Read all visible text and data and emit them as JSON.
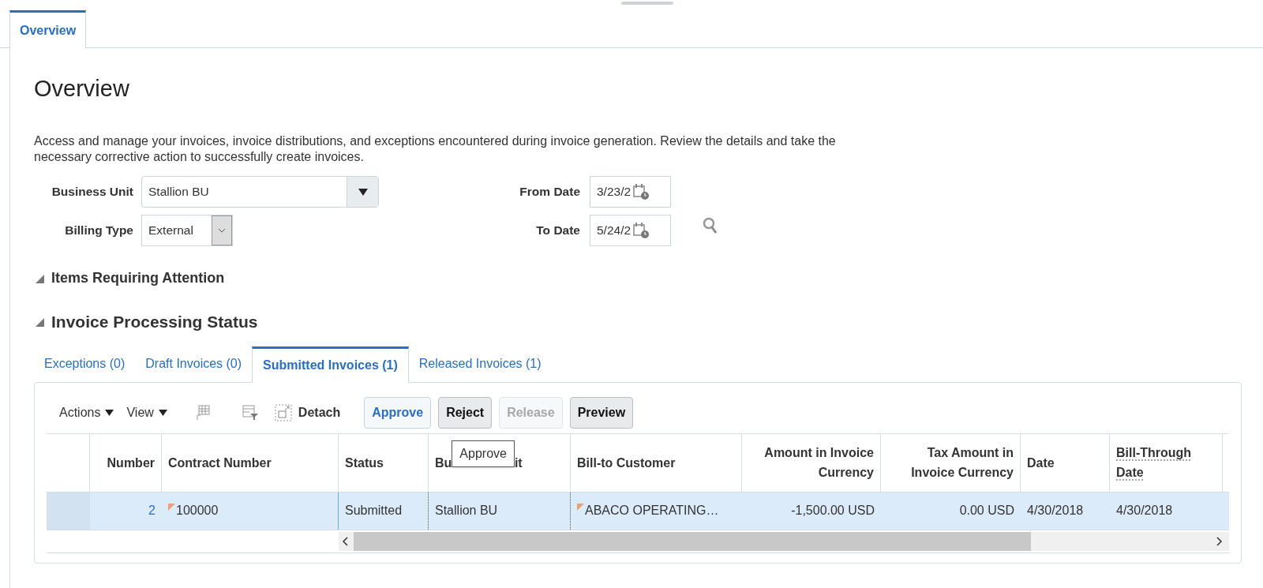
{
  "top_tabs": [
    {
      "label": "Overview",
      "selected": true
    }
  ],
  "page_title": "Overview",
  "description": "Access and manage your invoices, invoice distributions, and exceptions encountered during invoice generation. Review the details and take the necessary corrective action to successfully create invoices.",
  "filters": {
    "business_unit": {
      "label": "Business Unit",
      "value": "Stallion BU"
    },
    "billing_type": {
      "label": "Billing Type",
      "value": "External"
    },
    "from_date": {
      "label": "From Date",
      "value": "3/23/2"
    },
    "to_date": {
      "label": "To Date",
      "value": "5/24/2"
    }
  },
  "sections": [
    {
      "title": "Items Requiring Attention",
      "expanded": true
    },
    {
      "title": "Invoice Processing Status",
      "expanded": true
    }
  ],
  "status_tabs": [
    {
      "label": "Exceptions (0)",
      "selected": false
    },
    {
      "label": "Draft Invoices (0)",
      "selected": false
    },
    {
      "label": "Submitted Invoices (1)",
      "selected": true
    },
    {
      "label": "Released Invoices (1)",
      "selected": false
    }
  ],
  "toolbar": {
    "menus": [
      "Actions",
      "View"
    ],
    "detach": "Detach",
    "buttons": [
      {
        "label": "Approve",
        "disabled": false,
        "hovered": true
      },
      {
        "label": "Reject",
        "disabled": false,
        "hovered": false
      },
      {
        "label": "Release",
        "disabled": true,
        "hovered": false
      },
      {
        "label": "Preview",
        "disabled": false,
        "hovered": false
      }
    ]
  },
  "tooltip": "Approve",
  "table": {
    "columns": [
      {
        "label": "Number"
      },
      {
        "label": "Contract Number"
      },
      {
        "label": "Status"
      },
      {
        "label_start": "Bu",
        "label_end": "it"
      },
      {
        "label": "Bill-to Customer"
      },
      {
        "label": "Amount in Invoice Currency"
      },
      {
        "label": "Tax Amount in Invoice Currency"
      },
      {
        "label": "Date"
      },
      {
        "label": "Bill-Through Date",
        "dotted": true
      }
    ],
    "rows": [
      {
        "selected": true,
        "cells": [
          {
            "text": "2",
            "link": true
          },
          {
            "text": "100000",
            "flag": true
          },
          {
            "text": "Submitted"
          },
          {
            "text": "Stallion BU"
          },
          {
            "text": "ABACO OPERATING…",
            "flag": true
          },
          {
            "text": "-1,500.00 USD"
          },
          {
            "text": "0.00 USD"
          },
          {
            "text": "4/30/2018"
          },
          {
            "text": "4/30/2018"
          }
        ]
      }
    ]
  }
}
